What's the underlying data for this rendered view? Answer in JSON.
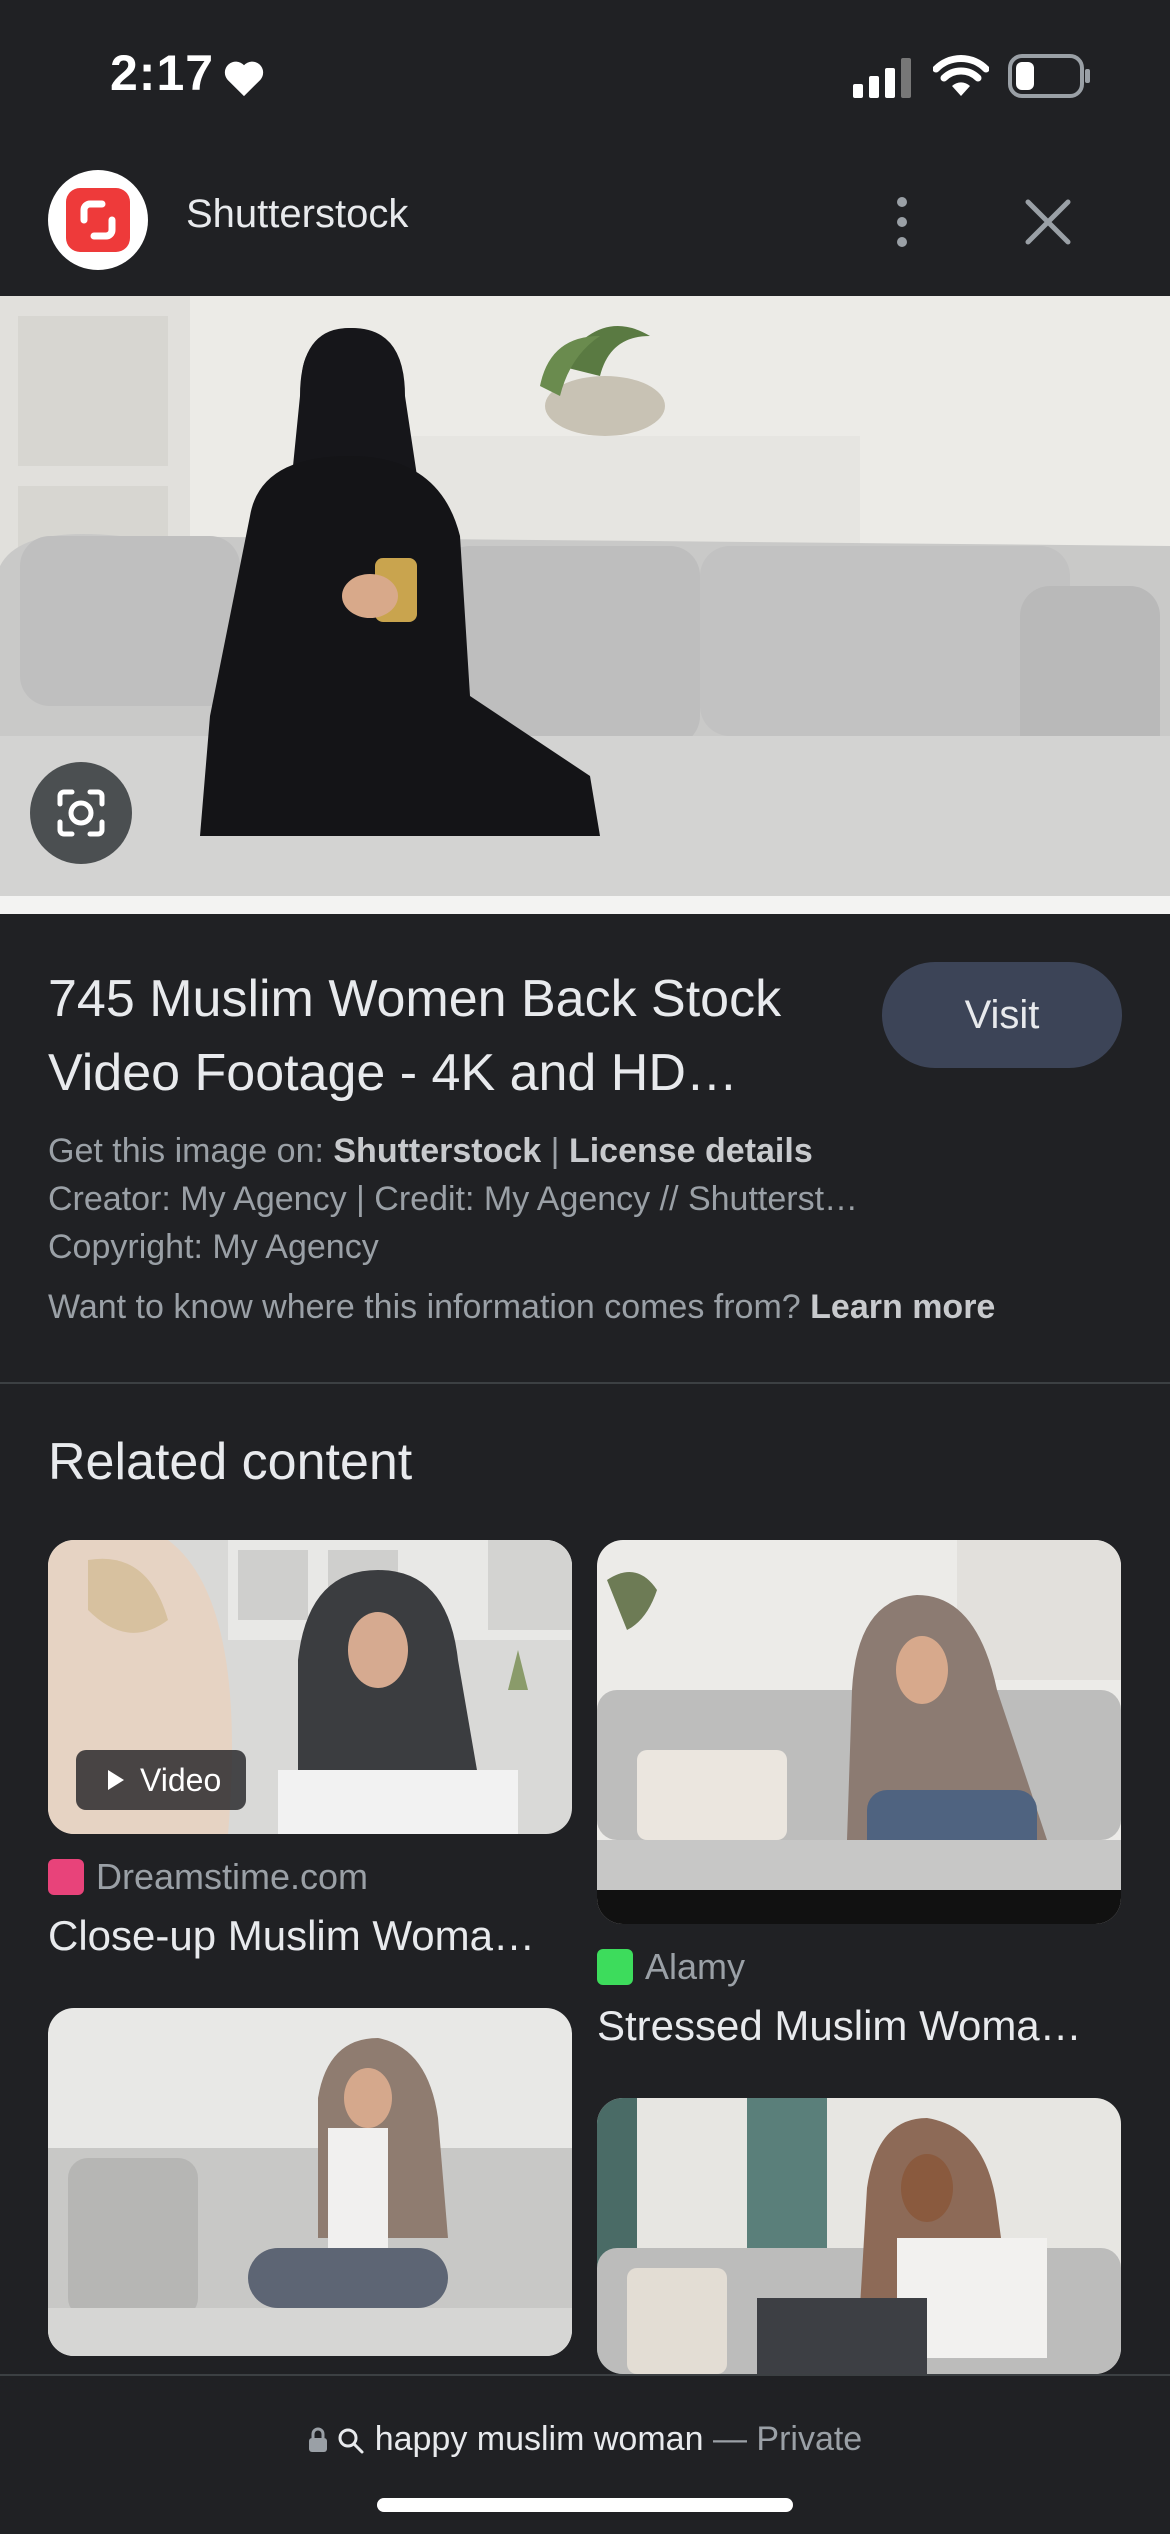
{
  "status_bar": {
    "time": "2:17"
  },
  "header": {
    "site_name": "Shutterstock"
  },
  "result": {
    "title_line1": "745 Muslim Women Back Stock",
    "title_line2": "Video Footage - 4K and HD…",
    "visit_label": "Visit",
    "get_image_prefix": "Get this image on:",
    "get_image_source": "Shutterstock",
    "separator": "|",
    "license_link": "License details",
    "creator_line": "Creator: My Agency | Credit: My Agency // Shutterst…",
    "copyright_line": "Copyright: My Agency",
    "info_question": "Want to know where this information comes from?",
    "learn_more": "Learn more"
  },
  "related": {
    "heading": "Related content",
    "cards": [
      {
        "source": "Dreamstime.com",
        "title": "Close-up Muslim Woma…",
        "badge": "Video"
      },
      {
        "source": "Alamy",
        "title": "Stressed Muslim Woma…"
      }
    ]
  },
  "bottom_bar": {
    "query": "happy muslim woman",
    "dash": "—",
    "mode": "Private"
  },
  "colors": {
    "background": "#202124",
    "visit_button": "#3c4457",
    "shutterstock_red": "#ee3a3a",
    "alamy_green": "#3ddc5c"
  }
}
